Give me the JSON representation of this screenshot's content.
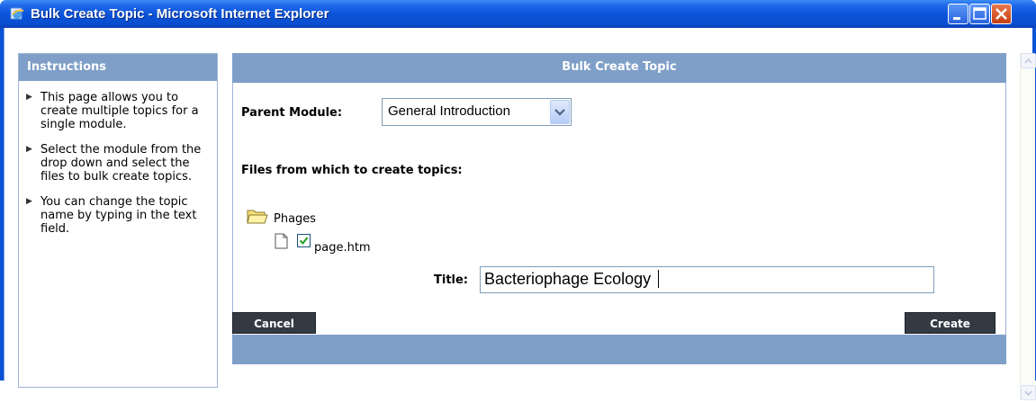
{
  "window": {
    "title": "Bulk Create Topic - Microsoft Internet Explorer",
    "icons": [
      "ie-icon",
      "minimize-icon",
      "maximize-icon",
      "close-icon"
    ]
  },
  "instructions": {
    "heading": "Instructions",
    "items": [
      "This page allows you to create multiple topics for a single module.",
      "Select the module from the drop down and select the files to bulk create topics.",
      "You can change the topic name by typing in the text field."
    ]
  },
  "form": {
    "heading": "Bulk Create Topic",
    "parent_module_label": "Parent Module:",
    "parent_module_value": "General Introduction",
    "files_label": "Files from which to create topics:",
    "folder_name": "Phages",
    "file_name": "page.htm",
    "file_checked": true,
    "title_label": "Title:",
    "title_value": "Bacteriophage Ecology",
    "cancel_label": "Cancel",
    "create_label": "Create"
  },
  "colors": {
    "titlebar": "#0a52d8",
    "panel_header": "#7f9fc8",
    "button": "#333a44"
  }
}
